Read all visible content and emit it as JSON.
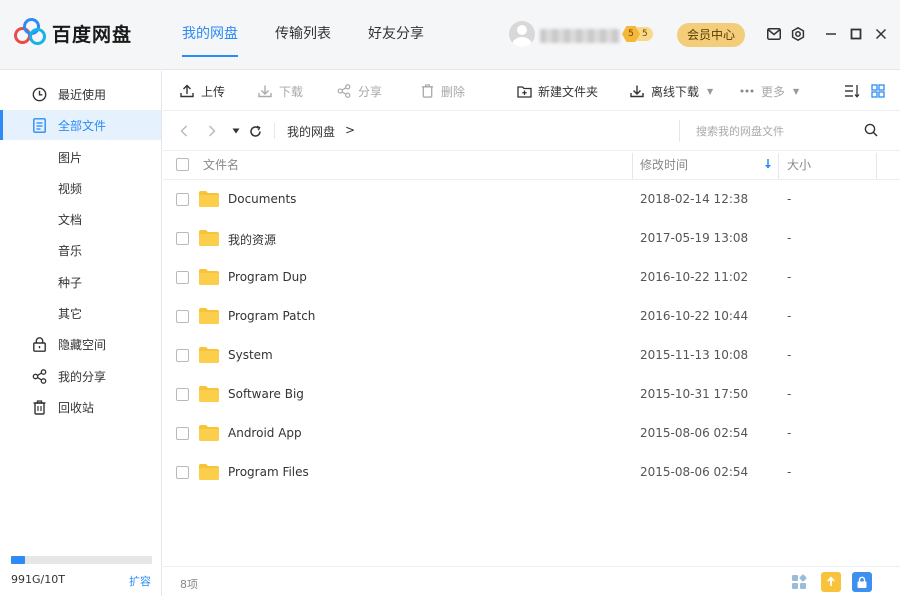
{
  "app": {
    "title": "百度网盘"
  },
  "nav": {
    "tabs": [
      {
        "label": "我的网盘",
        "active": true
      },
      {
        "label": "传输列表",
        "active": false
      },
      {
        "label": "好友分享",
        "active": false
      }
    ]
  },
  "user": {
    "level": "5",
    "level_pill": "5",
    "vip_label": "会员中心"
  },
  "sidebar": {
    "items": [
      {
        "label": "最近使用",
        "icon": "clock-icon"
      },
      {
        "label": "全部文件",
        "icon": "document-icon",
        "active": true
      },
      {
        "label": "图片"
      },
      {
        "label": "视频"
      },
      {
        "label": "文档"
      },
      {
        "label": "音乐"
      },
      {
        "label": "种子"
      },
      {
        "label": "其它"
      },
      {
        "label": "隐藏空间",
        "icon": "lock-icon"
      },
      {
        "label": "我的分享",
        "icon": "share-icon"
      },
      {
        "label": "回收站",
        "icon": "trash-icon"
      }
    ],
    "quota_text": "991G/10T",
    "quota_fraction": 0.097,
    "expand_label": "扩容"
  },
  "toolbar": {
    "upload": "上传",
    "download": "下载",
    "share": "分享",
    "delete": "删除",
    "new_folder": "新建文件夹",
    "offline_download": "离线下载",
    "more": "更多"
  },
  "address": {
    "breadcrumb": "我的网盘",
    "separator": ">",
    "search_placeholder": "搜索我的网盘文件"
  },
  "table": {
    "columns": {
      "name": "文件名",
      "modified": "修改时间",
      "size": "大小"
    },
    "rows": [
      {
        "name": "Documents",
        "modified": "2018-02-14 12:38",
        "size": "-"
      },
      {
        "name": "我的资源",
        "modified": "2017-05-19 13:08",
        "size": "-"
      },
      {
        "name": "Program Dup",
        "modified": "2016-10-22 11:02",
        "size": "-"
      },
      {
        "name": "Program Patch",
        "modified": "2016-10-22 10:44",
        "size": "-"
      },
      {
        "name": "System",
        "modified": "2015-11-13 10:08",
        "size": "-"
      },
      {
        "name": "Software Big",
        "modified": "2015-10-31 17:50",
        "size": "-"
      },
      {
        "name": "Android App",
        "modified": "2015-08-06 02:54",
        "size": "-"
      },
      {
        "name": "Program Files",
        "modified": "2015-08-06 02:54",
        "size": "-"
      }
    ]
  },
  "status": {
    "count": "8项"
  },
  "colors": {
    "accent": "#2c8bf5",
    "folder": "#f8c23a",
    "vip": "#f3cd7a"
  }
}
